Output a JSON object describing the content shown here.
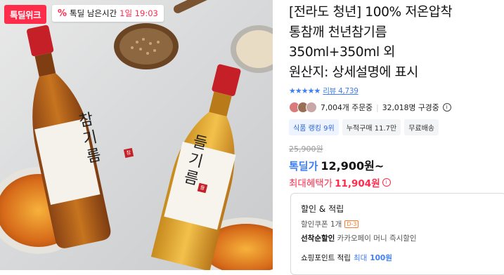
{
  "image": {
    "alt": "Two bottles of Korean sesame oil with bowls and a wooden spoon of seeds"
  },
  "badge": {
    "label": "톡딜위크"
  },
  "timer": {
    "icon": "percent-icon",
    "glyph": "%",
    "label": "톡딜 남은시간",
    "time": "1일 19:03"
  },
  "bottle_labels": {
    "left": "참기름",
    "right": "들기름",
    "small": "참",
    "small2": "들"
  },
  "title": {
    "line1": "[전라도 청년] 100% 저온압착",
    "line2": "통참깨 천년참기름",
    "line3": "350ml+350ml 외",
    "line4": "원산지: 상세설명에 표시"
  },
  "rating": {
    "stars": "★★★★★",
    "review": "리뷰 4,739"
  },
  "buyers": {
    "orders": "7,004개 주문중",
    "divider": "|",
    "subs": "32,018명 구경중",
    "info": "i"
  },
  "tags": [
    "식품 랭킹 9위",
    "누적구매 11.7만",
    "무료배송"
  ],
  "price": {
    "original": "25,900원",
    "deal_label": "톡딜가",
    "deal_value": "12,900원~",
    "max_label": "최대혜택가",
    "max_value": "11,904원"
  },
  "discount": {
    "header": "할인 & 적립",
    "coupon_label": "할인쿠폰 1개",
    "coupon_chip": "D-3",
    "pay_label": "선착순할인",
    "pay_text": "카카오페이 머니 즉시할인",
    "points_label": "쇼핑포인트 적립",
    "points_max": "최대",
    "points_value": "100원"
  },
  "colors": {
    "accent_red": "#ff2b4a",
    "accent_blue": "#3e7ef6"
  }
}
